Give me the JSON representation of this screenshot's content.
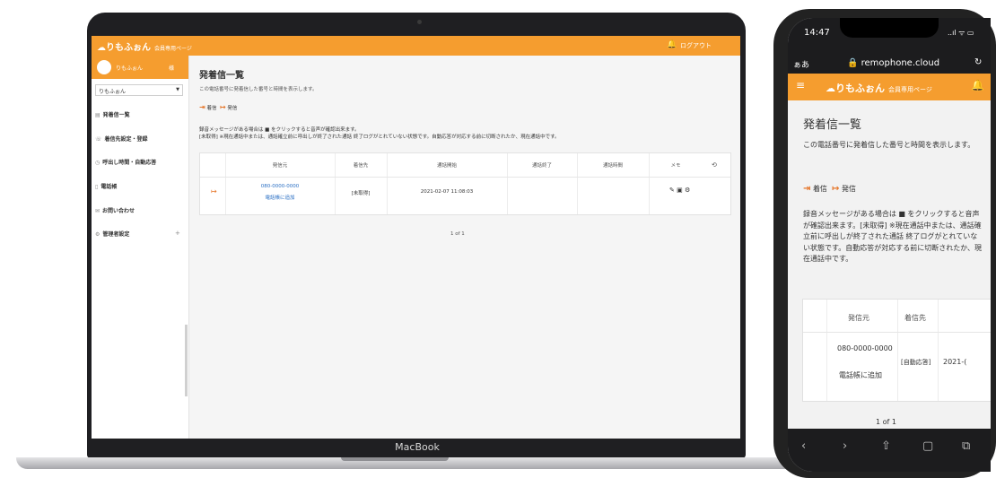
{
  "laptop": {
    "label": "MacBook",
    "header": {
      "logo": "りもふぉん",
      "logo_sub": "会員専用ページ",
      "logout": "ログアウト"
    },
    "sidebar": {
      "user_name": "りもふぉん",
      "user_suffix": "様",
      "select_value": "りもふぉん",
      "items": [
        {
          "label": "発着信一覧"
        },
        {
          "label": "着信先設定・登録"
        },
        {
          "label": "呼出し時間・自動応答"
        },
        {
          "label": "電話帳"
        },
        {
          "label": "お問い合わせ"
        },
        {
          "label": "管理者設定"
        }
      ]
    },
    "main": {
      "title": "発着信一覧",
      "description": "この電話番号に発着信した番号と時間を表示します。",
      "legend_in": "着信",
      "legend_out": "発信",
      "note1": "録音メッセージがある場合は ■ をクリックすると音声が確認出来ます。",
      "note2": "[未取得] ※現在通話中または、通話確立前に呼出しが終了された通話 終了ログがとれていない状態です。自動応答が対応する前に切断されたか、現在通話中です。",
      "columns": [
        "発信元",
        "着信先",
        "通話開始",
        "通話終了",
        "通話時間",
        "メモ"
      ],
      "row": {
        "from": "080-0000-0000",
        "add_contact": "電話帳に追加",
        "to": "[未取得]",
        "start": "2021-02-07 11:08:03",
        "end": "",
        "duration": ""
      },
      "pagination": "1 of 1"
    }
  },
  "phone": {
    "time": "14:47",
    "signal": "..ıl ᯤ ▭",
    "url_aa": "ぁあ",
    "domain": "remophone.cloud",
    "header": {
      "logo": "りもふぉん",
      "logo_sub": "会員専用ページ"
    },
    "title": "発着信一覧",
    "description": "この電話番号に発着信した番号と時間を表示します。",
    "legend_in": "着信",
    "legend_out": "発信",
    "note": "録音メッセージがある場合は ■ をクリックすると音声が確認出来ます。[未取得] ※現在通話中または、通話確立前に呼出しが終了された通話 終了ログがとれていない状態です。自動応答が対応する前に切断されたか、現在通話中です。",
    "columns": [
      "発信元",
      "着信先"
    ],
    "row": {
      "from": "080-0000-0000",
      "add_contact": "電話帳に追加",
      "to": "[自動応答]",
      "start": "2021-("
    },
    "pagination": "1 of 1"
  }
}
